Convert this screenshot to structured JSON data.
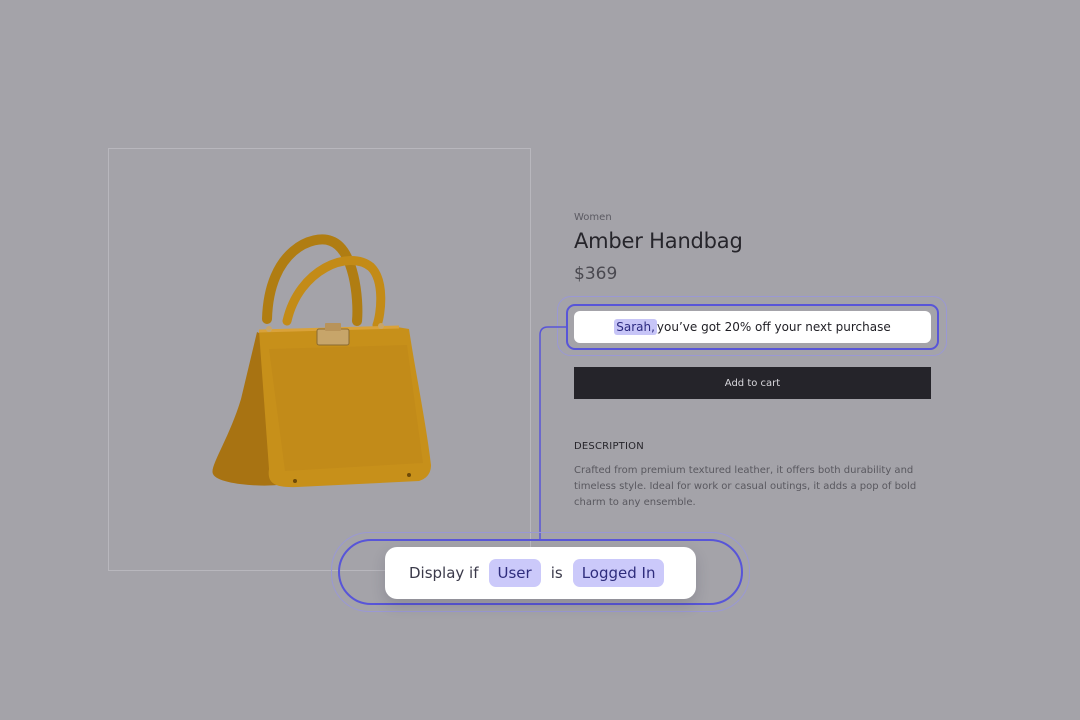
{
  "product": {
    "category": "Women",
    "title": "Amber Handbag",
    "price": "$369",
    "image_alt": "Amber handbag",
    "add_to_cart_label": "Add to cart",
    "description_heading": "DESCRIPTION",
    "description_lines": [
      "Crafted from premium textured leather, it offers both durability and",
      "timeless style. Ideal for work or casual outings, it adds a pop of bold",
      "charm to any ensemble."
    ]
  },
  "promo": {
    "name": "Sarah,",
    "message": " you’ve got 20% off your next purchase"
  },
  "condition": {
    "prefix": "Display if",
    "subject": "User",
    "operator": "is",
    "value": "Logged In"
  },
  "colors": {
    "accent": "#5855d8",
    "chip": "#cbc9fa",
    "bag": "#c7901a",
    "button": "#25242a",
    "background": "#a5a4aa"
  }
}
